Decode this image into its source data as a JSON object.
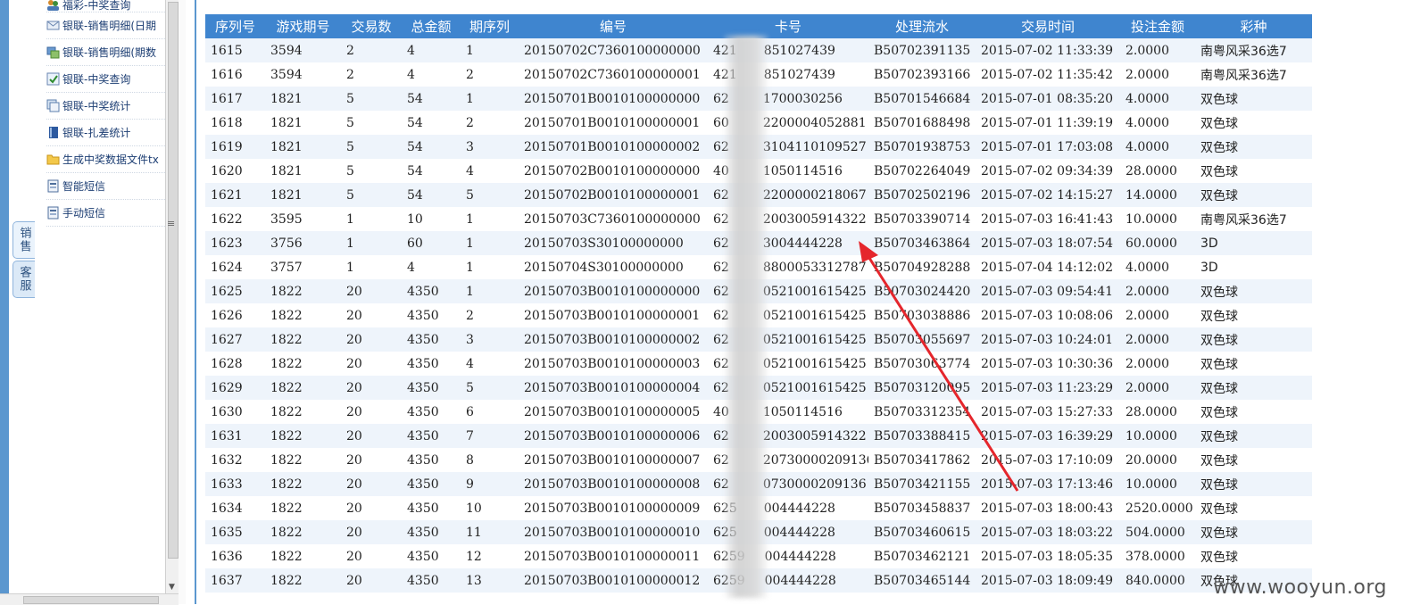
{
  "side_tabs": [
    {
      "label": "销售"
    },
    {
      "label": "客服"
    }
  ],
  "menu": {
    "items": [
      {
        "label": "福彩-中奖查询",
        "icon": "users-icon"
      },
      {
        "label": "银联-销售明细(日期",
        "icon": "envelope-icon"
      },
      {
        "label": "银联-销售明细(期数",
        "icon": "cards-icon"
      },
      {
        "label": "银联-中奖查询",
        "icon": "check-icon"
      },
      {
        "label": "银联-中奖统计",
        "icon": "stack-icon"
      },
      {
        "label": "银联-扎差统计",
        "icon": "book-icon"
      },
      {
        "label": "生成中奖数据文件tx",
        "icon": "folder-icon"
      },
      {
        "label": "智能短信",
        "icon": "document-icon"
      },
      {
        "label": "手动短信",
        "icon": "document-icon"
      }
    ]
  },
  "table": {
    "headers": [
      "序列号",
      "游戏期号",
      "交易数",
      "总金额",
      "期序列",
      "编号",
      "卡号",
      "处理流水",
      "交易时间",
      "投注金额",
      "彩种"
    ],
    "rows": [
      [
        "1615",
        "3594",
        "2",
        "4",
        "1",
        "20150702C7360100000000",
        "421",
        "851027439",
        "B50702391135",
        "2015-07-02 11:33:39",
        "2.0000",
        "南粤风采36选7"
      ],
      [
        "1616",
        "3594",
        "2",
        "4",
        "2",
        "20150702C7360100000001",
        "421",
        "851027439",
        "B50702393166",
        "2015-07-02 11:35:42",
        "2.0000",
        "南粤风采36选7"
      ],
      [
        "1617",
        "1821",
        "5",
        "54",
        "1",
        "20150701B0010100000000",
        "62",
        "1700030256",
        "B50701546684",
        "2015-07-01 08:35:20",
        "4.0000",
        "双色球"
      ],
      [
        "1618",
        "1821",
        "5",
        "54",
        "2",
        "20150701B0010100000001",
        "60",
        "2200004052881",
        "B50701688498",
        "2015-07-01 11:39:19",
        "4.0000",
        "双色球"
      ],
      [
        "1619",
        "1821",
        "5",
        "54",
        "3",
        "20150701B0010100000002",
        "62",
        "3104110109527",
        "B50701938753",
        "2015-07-01 17:03:08",
        "4.0000",
        "双色球"
      ],
      [
        "1620",
        "1821",
        "5",
        "54",
        "4",
        "20150702B0010100000000",
        "40",
        "1050114516",
        "B50702264049",
        "2015-07-02 09:34:39",
        "28.0000",
        "双色球"
      ],
      [
        "1621",
        "1821",
        "5",
        "54",
        "5",
        "20150702B0010100000001",
        "62",
        "2200000218067",
        "B50702502196",
        "2015-07-02 14:15:27",
        "14.0000",
        "双色球"
      ],
      [
        "1622",
        "3595",
        "1",
        "10",
        "1",
        "20150703C7360100000000",
        "62",
        "2003005914322",
        "B50703390714",
        "2015-07-03 16:41:43",
        "10.0000",
        "南粤风采36选7"
      ],
      [
        "1623",
        "3756",
        "1",
        "60",
        "1",
        "20150703S30100000000",
        "62",
        "3004444228",
        "B50703463864",
        "2015-07-03 18:07:54",
        "60.0000",
        "3D"
      ],
      [
        "1624",
        "3757",
        "1",
        "4",
        "1",
        "20150704S30100000000",
        "62",
        "8800053312787",
        "B50704928288",
        "2015-07-04 14:12:02",
        "4.0000",
        "3D"
      ],
      [
        "1625",
        "1822",
        "20",
        "4350",
        "1",
        "20150703B0010100000000",
        "62",
        "0521001615425",
        "B50703024420",
        "2015-07-03 09:54:41",
        "2.0000",
        "双色球"
      ],
      [
        "1626",
        "1822",
        "20",
        "4350",
        "2",
        "20150703B0010100000001",
        "62",
        "0521001615425",
        "B50703038886",
        "2015-07-03 10:08:06",
        "2.0000",
        "双色球"
      ],
      [
        "1627",
        "1822",
        "20",
        "4350",
        "3",
        "20150703B0010100000002",
        "62",
        "0521001615425",
        "B50703055697",
        "2015-07-03 10:24:01",
        "2.0000",
        "双色球"
      ],
      [
        "1628",
        "1822",
        "20",
        "4350",
        "4",
        "20150703B0010100000003",
        "62",
        "0521001615425",
        "B50703063774",
        "2015-07-03 10:30:36",
        "2.0000",
        "双色球"
      ],
      [
        "1629",
        "1822",
        "20",
        "4350",
        "5",
        "20150703B0010100000004",
        "62",
        "0521001615425",
        "B50703120095",
        "2015-07-03 11:23:29",
        "2.0000",
        "双色球"
      ],
      [
        "1630",
        "1822",
        "20",
        "4350",
        "6",
        "20150703B0010100000005",
        "40",
        "1050114516",
        "B50703312354",
        "2015-07-03 15:27:33",
        "28.0000",
        "双色球"
      ],
      [
        "1631",
        "1822",
        "20",
        "4350",
        "7",
        "20150703B0010100000006",
        "62",
        "2003005914322",
        "B50703388415",
        "2015-07-03 16:39:29",
        "10.0000",
        "双色球"
      ],
      [
        "1632",
        "1822",
        "20",
        "4350",
        "8",
        "20150703B0010100000007",
        "62",
        "20730000209136",
        "B50703417862",
        "2015-07-03 17:10:09",
        "20.0000",
        "双色球"
      ],
      [
        "1633",
        "1822",
        "20",
        "4350",
        "9",
        "20150703B0010100000008",
        "62",
        "0730000209136",
        "B50703421155",
        "2015-07-03 17:13:46",
        "10.0000",
        "双色球"
      ],
      [
        "1634",
        "1822",
        "20",
        "4350",
        "10",
        "20150703B0010100000009",
        "625",
        "004444228",
        "B50703458837",
        "2015-07-03 18:00:43",
        "2520.0000",
        "双色球"
      ],
      [
        "1635",
        "1822",
        "20",
        "4350",
        "11",
        "20150703B0010100000010",
        "625",
        "004444228",
        "B50703460615",
        "2015-07-03 18:03:22",
        "504.0000",
        "双色球"
      ],
      [
        "1636",
        "1822",
        "20",
        "4350",
        "12",
        "20150703B0010100000011",
        "6259",
        "004444228",
        "B50703462121",
        "2015-07-03 18:05:35",
        "378.0000",
        "双色球"
      ],
      [
        "1637",
        "1822",
        "20",
        "4350",
        "13",
        "20150703B0010100000012",
        "6259",
        "004444228",
        "B50703465144",
        "2015-07-03 18:09:49",
        "840.0000",
        "双色球"
      ]
    ]
  },
  "annotation": {
    "color": "#e5262c"
  },
  "watermark": "www.wooyun.org"
}
